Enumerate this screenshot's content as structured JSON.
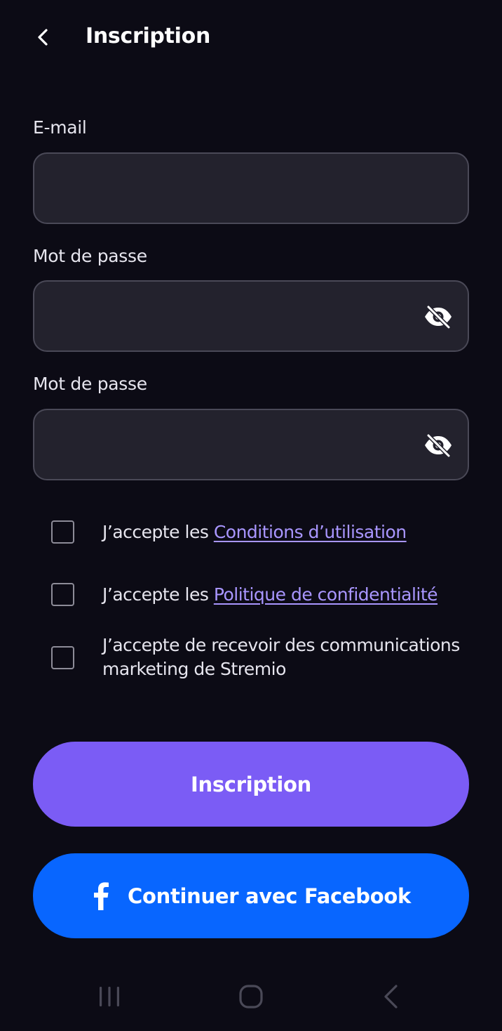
{
  "header": {
    "title": "Inscription",
    "back_icon": "chevron-left-icon"
  },
  "form": {
    "email": {
      "label": "E-mail",
      "value": "",
      "placeholder": ""
    },
    "password": {
      "label": "Mot de passe",
      "value": "",
      "placeholder": "",
      "toggle_icon": "eye-off-icon"
    },
    "password_confirm": {
      "label": "Mot de passe",
      "value": "",
      "placeholder": "",
      "toggle_icon": "eye-off-icon"
    }
  },
  "consents": [
    {
      "text": "J’accepte les ",
      "link": "Conditions d’utilisation",
      "checked": false
    },
    {
      "text": "J’accepte les ",
      "link": "Politique de confidentialité",
      "checked": false
    },
    {
      "text": "J’accepte de recevoir des communications marketing de Stremio",
      "checked": false
    }
  ],
  "buttons": {
    "signup_label": "Inscription",
    "facebook_label": "Continuer avec Facebook",
    "facebook_icon": "facebook-icon"
  },
  "colors": {
    "background": "#0c0b15",
    "input_bg": "#23222d",
    "input_border": "#4a4957",
    "accent": "#7b5cf5",
    "link": "#a996ff",
    "facebook": "#0866ff"
  },
  "system_nav": {
    "recent_icon": "recent-apps-icon",
    "home_icon": "home-icon",
    "back_icon": "back-icon"
  }
}
